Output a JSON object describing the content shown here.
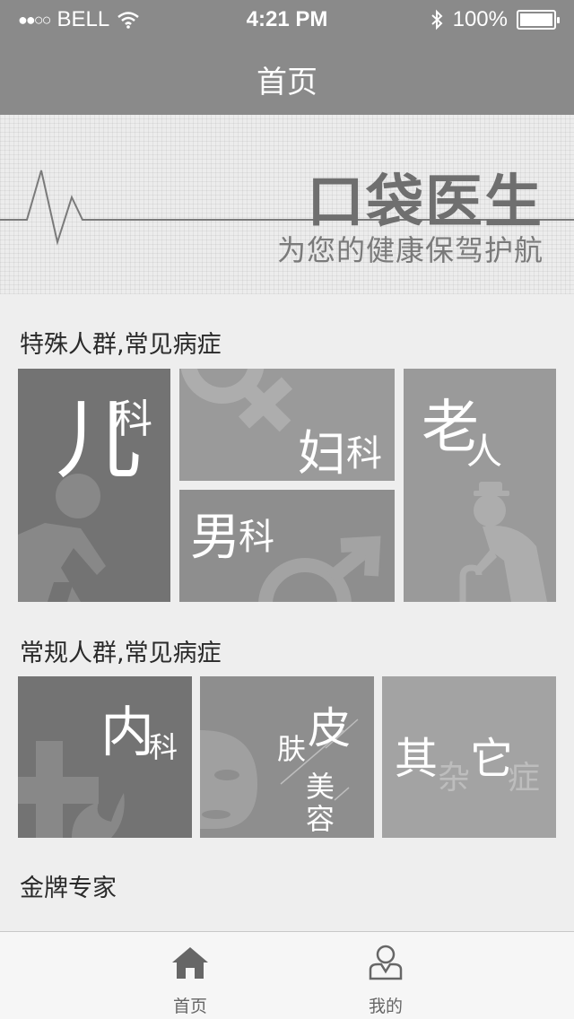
{
  "status_bar": {
    "signal_dots": "●●○○",
    "carrier": "BELL",
    "time": "4:21 PM",
    "battery_percent": "100%",
    "icons": [
      "wifi-icon",
      "bluetooth-icon",
      "battery-icon"
    ]
  },
  "nav": {
    "title": "首页"
  },
  "banner": {
    "brand": "口袋医生",
    "slogan": "为您的健康保驾护航"
  },
  "sections": {
    "special": {
      "title": "特殊人群,常见病症",
      "tiles": {
        "pediatrics": {
          "big": "儿",
          "small": "科"
        },
        "gynecology": {
          "big": "妇",
          "small": "科"
        },
        "andrology": {
          "big": "男",
          "small": "科"
        },
        "geriatrics": {
          "big": "老",
          "small": "人"
        }
      }
    },
    "regular": {
      "title": "常规人群,常见病症",
      "tiles": {
        "internal": {
          "big": "内",
          "small": "科"
        },
        "dermatology": {
          "char1": "皮",
          "char2": "肤",
          "char3": "美",
          "char4": "容"
        },
        "other": {
          "char1": "其",
          "char2": "杂",
          "char3": "它",
          "char4": "症"
        }
      }
    },
    "experts": {
      "title": "金牌专家"
    }
  },
  "tabbar": {
    "home_label": "首页",
    "mine_label": "我的"
  },
  "colors": {
    "nav_bg": "#8a8a8a",
    "tile_dark": "#737373",
    "tile_mid": "#8e8e8e",
    "tile_light": "#9a9a9a",
    "tile_lighter": "#a3a3a3",
    "page_bg": "#eeeeee"
  }
}
